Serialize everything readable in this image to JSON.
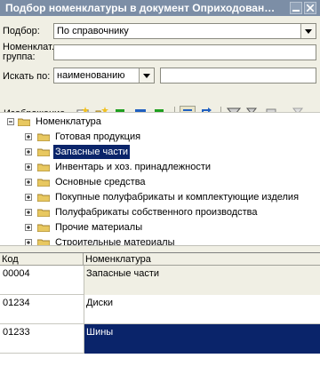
{
  "window": {
    "title": "Подбор номенклатуры в документ Оприходование ..."
  },
  "form": {
    "podbor_label": "Подбор:",
    "podbor_value": "По справочнику",
    "group_label_1": "Номенклат.",
    "group_label_2": "группа:",
    "group_value": "",
    "search_label": "Искать по:",
    "search_by_value": "наименованию",
    "search_text": ""
  },
  "toolbar": {
    "image_label": "Изображение"
  },
  "tree": {
    "root": "Номенклатура",
    "items": [
      {
        "label": "Готовая продукция"
      },
      {
        "label": "Запасные части"
      },
      {
        "label": "Инвентарь и хоз. принадлежности"
      },
      {
        "label": "Основные средства"
      },
      {
        "label": "Покупные полуфабрикаты и комплектующие изделия"
      },
      {
        "label": "Полуфабрикаты собственного производства"
      },
      {
        "label": "Прочие материалы"
      },
      {
        "label": "Строительные материалы"
      }
    ],
    "selected_index": 1
  },
  "table": {
    "columns": [
      "Код",
      "Номенклатура"
    ],
    "rows": [
      {
        "code": "00004",
        "name": "Запасные части"
      },
      {
        "code": "01234",
        "name": "Диски"
      },
      {
        "code": "01233",
        "name": "Шины"
      }
    ],
    "selected_row": 2
  },
  "colors": {
    "title_bg": "#7c8ea6",
    "selection": "#0a246a",
    "panel": "#f0efe4"
  }
}
